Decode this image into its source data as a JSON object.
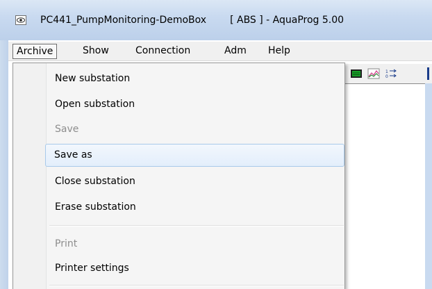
{
  "window": {
    "title_left": "PC441_PumpMonitoring-DemoBox",
    "title_right": "[ ABS ] - AquaProg 5.00",
    "icon": "eye-icon"
  },
  "menubar": {
    "items": [
      {
        "label": "Archive",
        "active": true
      },
      {
        "label": "Show",
        "active": false
      },
      {
        "label": "Connection",
        "active": false
      },
      {
        "label": "Adm",
        "active": false
      },
      {
        "label": "Help",
        "active": false
      }
    ]
  },
  "dropdown": {
    "items": [
      {
        "label": "New substation",
        "enabled": true
      },
      {
        "label": "Open substation",
        "enabled": true
      },
      {
        "label": "Save",
        "enabled": false
      },
      {
        "label": "Save as",
        "enabled": true,
        "hovered": true
      },
      {
        "label": "Close substation",
        "enabled": true
      },
      {
        "label": "Erase substation",
        "enabled": true
      },
      {
        "label": "Print",
        "enabled": false
      },
      {
        "label": "Printer settings",
        "enabled": true
      }
    ]
  },
  "toolbar": {
    "icons": [
      "display-icon",
      "chart-icon",
      "sort-icon"
    ]
  },
  "colors": {
    "titlebar": "#c9daf0",
    "hover_border": "#a8c9ea",
    "disabled_text": "#8d8d8d"
  }
}
